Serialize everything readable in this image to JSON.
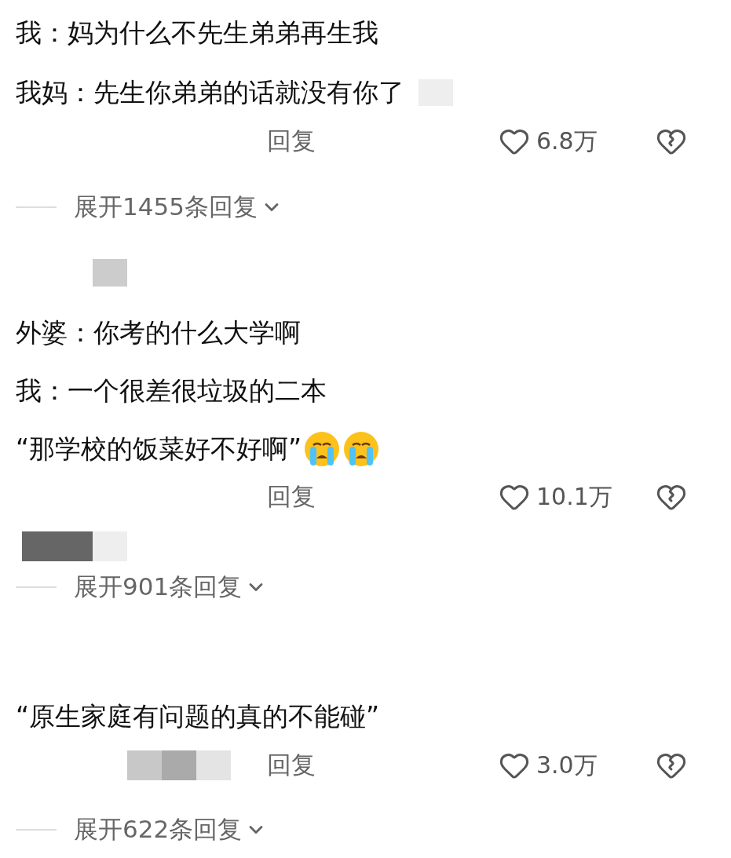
{
  "comments": [
    {
      "lines": [
        "我：妈为什么不先生弟弟再生我",
        "我妈：先生你弟弟的话就没有你了"
      ],
      "reply": "回复",
      "likes": "6.8万",
      "expand": "展开1455条回复"
    },
    {
      "lines": [
        "外婆：你考的什么大学啊",
        "我：一个很差很垃圾的二本",
        "“那学校的饭菜好不好啊”"
      ],
      "emojis": [
        {
          "kind": "crying"
        },
        {
          "kind": "crying"
        }
      ],
      "reply": "回复",
      "likes": "10.1万",
      "expand": "展开901条回复"
    },
    {
      "lines": [
        "“原生家庭有问题的真的不能碰”"
      ],
      "reply": "回复",
      "likes": "3.0万",
      "expand": "展开622条回复"
    }
  ]
}
